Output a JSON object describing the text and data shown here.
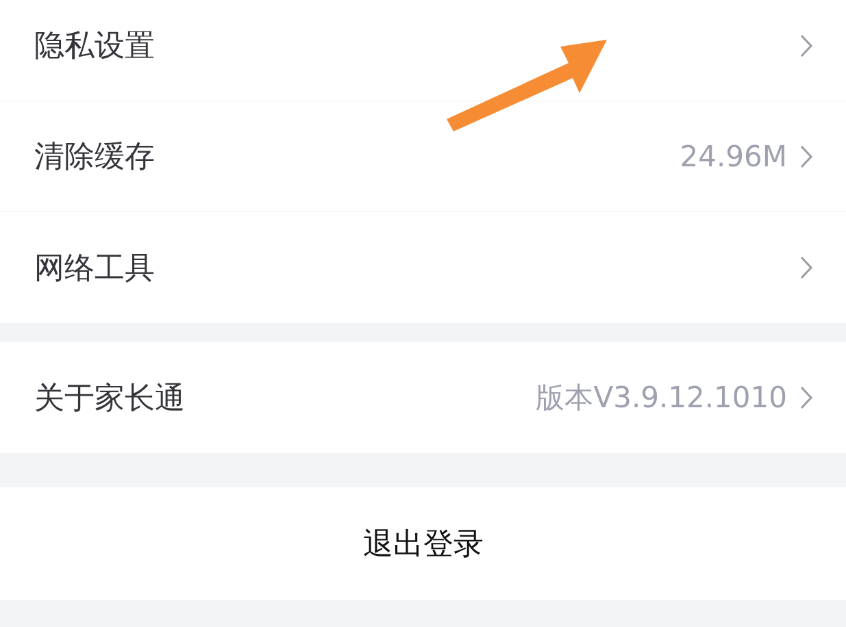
{
  "groups": [
    {
      "items": [
        {
          "label": "隐私设置"
        },
        {
          "label": "清除缓存",
          "value": "24.96M"
        },
        {
          "label": "网络工具"
        }
      ]
    },
    {
      "items": [
        {
          "label": "关于家长通",
          "value": "版本V3.9.12.1010"
        }
      ]
    }
  ],
  "logout_button": {
    "label": "退出登录"
  },
  "annotation": {
    "kind": "arrow"
  }
}
